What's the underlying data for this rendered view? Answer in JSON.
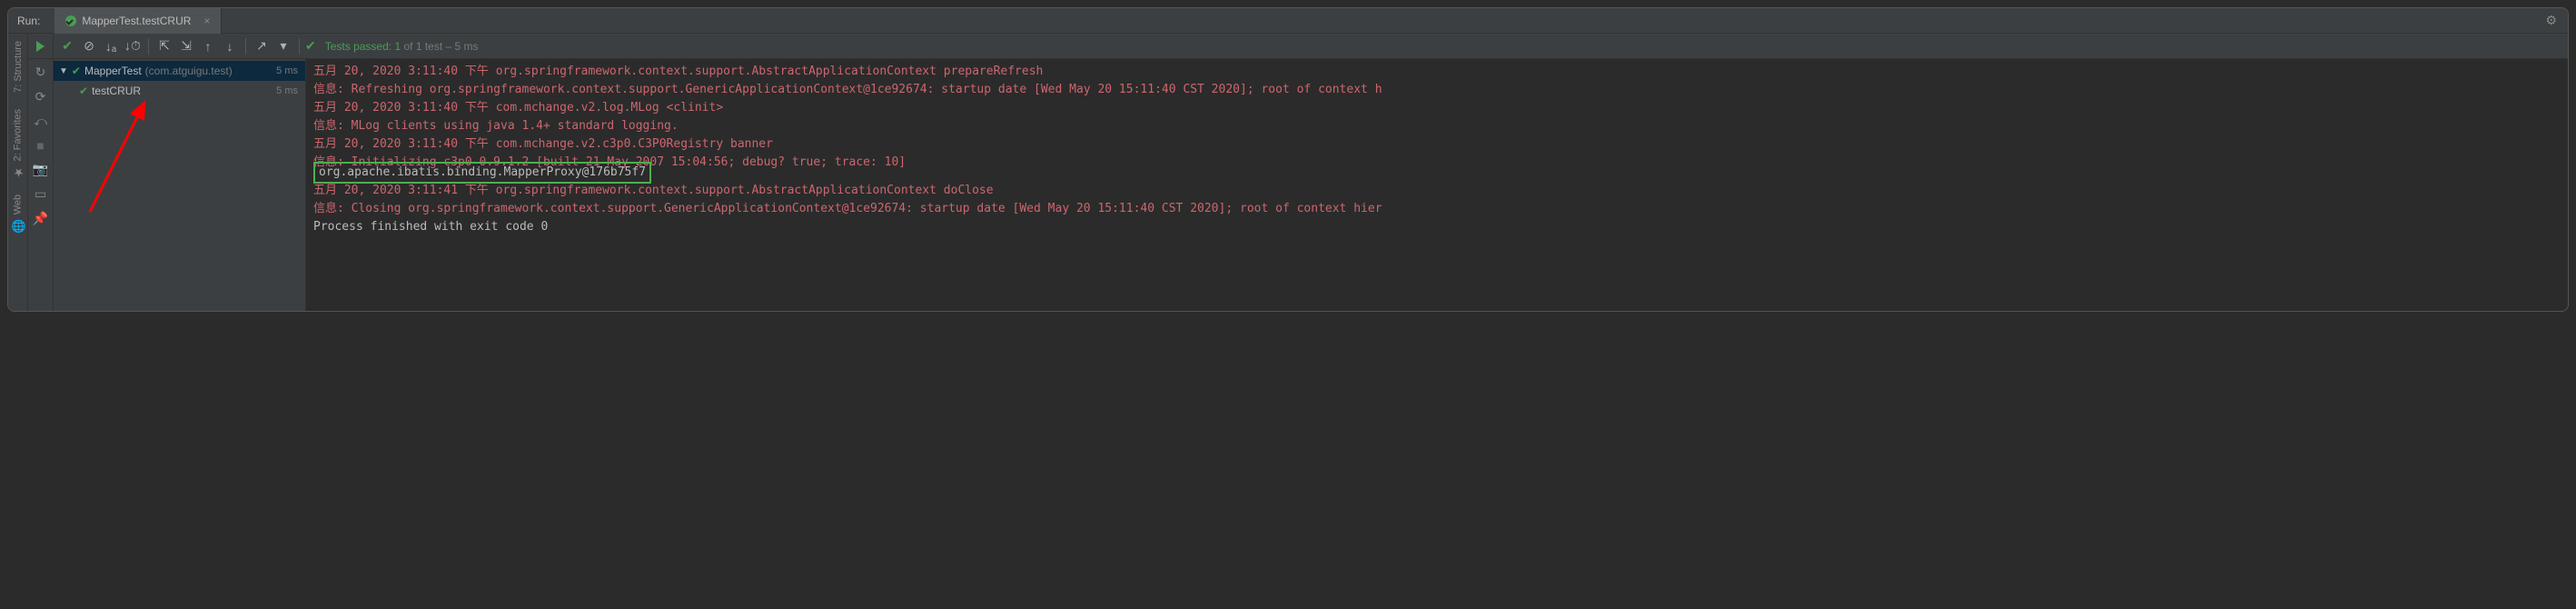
{
  "header": {
    "run_label": "Run:",
    "tab_label": "MapperTest.testCRUR",
    "tab_close": "×"
  },
  "sidebar": {
    "structure": "7: Structure",
    "favorites": "2: Favorites",
    "web": "Web"
  },
  "toolbar": {
    "status_prefix": "Tests passed:",
    "status_count": "1",
    "status_of": "of 1 test",
    "status_time": "– 5 ms"
  },
  "tree": {
    "root_label": "MapperTest",
    "root_pkg": "(com.atguigu.test)",
    "root_time": "5 ms",
    "child_label": "testCRUR",
    "child_time": "5 ms"
  },
  "console": {
    "line1": "五月 20, 2020 3:11:40 下午 org.springframework.context.support.AbstractApplicationContext prepareRefresh",
    "line2": "信息: Refreshing org.springframework.context.support.GenericApplicationContext@1ce92674: startup date [Wed May 20 15:11:40 CST 2020]; root of context h",
    "line3": "五月 20, 2020 3:11:40 下午 com.mchange.v2.log.MLog <clinit>",
    "line4": "信息: MLog clients using java 1.4+ standard logging.",
    "line5": "五月 20, 2020 3:11:40 下午 com.mchange.v2.c3p0.C3P0Registry banner",
    "line6": "信息: Initializing c3p0-0.9.1.2 [built 21-May-2007 15:04:56; debug? true; trace: 10]",
    "line7_boxed": "org.apache.ibatis.binding.MapperProxy@176b75f7",
    "line8": "五月 20, 2020 3:11:41 下午 org.springframework.context.support.AbstractApplicationContext doClose",
    "line9": "信息: Closing org.springframework.context.support.GenericApplicationContext@1ce92674: startup date [Wed May 20 15:11:40 CST 2020]; root of context hier",
    "line10": "",
    "line11": "Process finished with exit code 0"
  }
}
